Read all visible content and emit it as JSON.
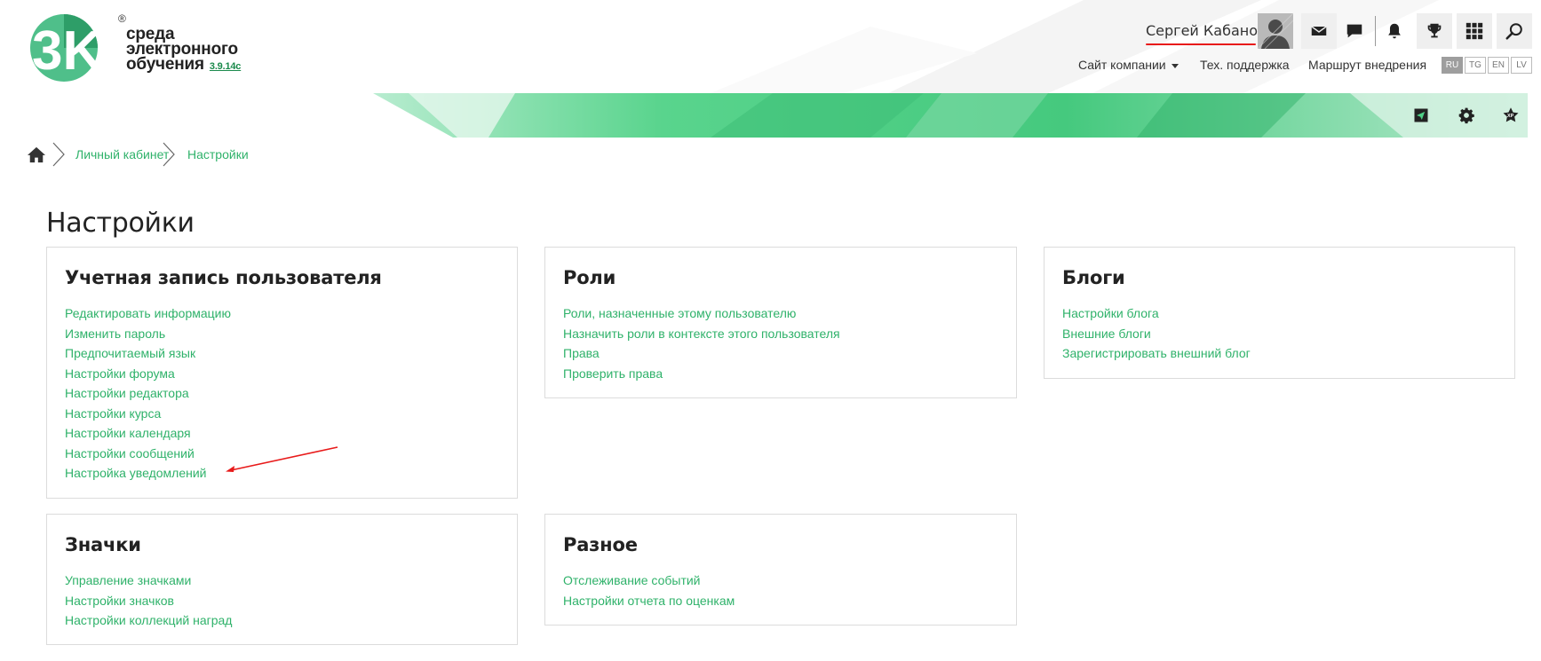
{
  "header": {
    "logo": {
      "mark": "3K",
      "reg": "®",
      "line1": "среда",
      "line2": "электронного",
      "line3": "обучения",
      "version": "3.9.14c"
    },
    "user": {
      "name": "Сергей Кабанов",
      "avatar_icon": "user-avatar-silhouette"
    },
    "icons": [
      "envelope-icon",
      "chat-bubble-icon",
      "bell-icon",
      "trophy-icon",
      "grid-apps-icon",
      "search-icon"
    ],
    "nav": {
      "company_site": "Сайт компании",
      "support": "Тех. поддержка",
      "route": "Маршрут внедрения"
    },
    "languages": [
      {
        "code": "RU",
        "active": true
      },
      {
        "code": "TG",
        "active": false
      },
      {
        "code": "EN",
        "active": false
      },
      {
        "code": "LV",
        "active": false
      }
    ],
    "banner_icons": [
      "paper-plane-icon",
      "gear-icon",
      "xp-star-icon"
    ],
    "colors": {
      "accent_green": "#2fb26a",
      "banner_green": "#4fcf86",
      "underline_red": "#e81a1a"
    }
  },
  "breadcrumb": {
    "home_icon": "home-icon",
    "items": [
      "Личный кабинет",
      "Настройки"
    ]
  },
  "page": {
    "title": "Настройки"
  },
  "cards": {
    "account": {
      "title": "Учетная запись пользователя",
      "links": [
        "Редактировать информацию",
        "Изменить пароль",
        "Предпочитаемый язык",
        "Настройки форума",
        "Настройки редактора",
        "Настройки курса",
        "Настройки календаря",
        "Настройки сообщений",
        "Настройка уведомлений"
      ]
    },
    "roles": {
      "title": "Роли",
      "links": [
        "Роли, назначенные этому пользователю",
        "Назначить роли в контексте этого пользователя",
        "Права",
        "Проверить права"
      ]
    },
    "blogs": {
      "title": "Блоги",
      "links": [
        "Настройки блога",
        "Внешние блоги",
        "Зарегистрировать внешний блог"
      ]
    },
    "badges": {
      "title": "Значки",
      "links": [
        "Управление значками",
        "Настройки значков",
        "Настройки коллекций наград"
      ]
    },
    "misc": {
      "title": "Разное",
      "links": [
        "Отслеживание событий",
        "Настройки отчета по оценкам"
      ]
    }
  }
}
